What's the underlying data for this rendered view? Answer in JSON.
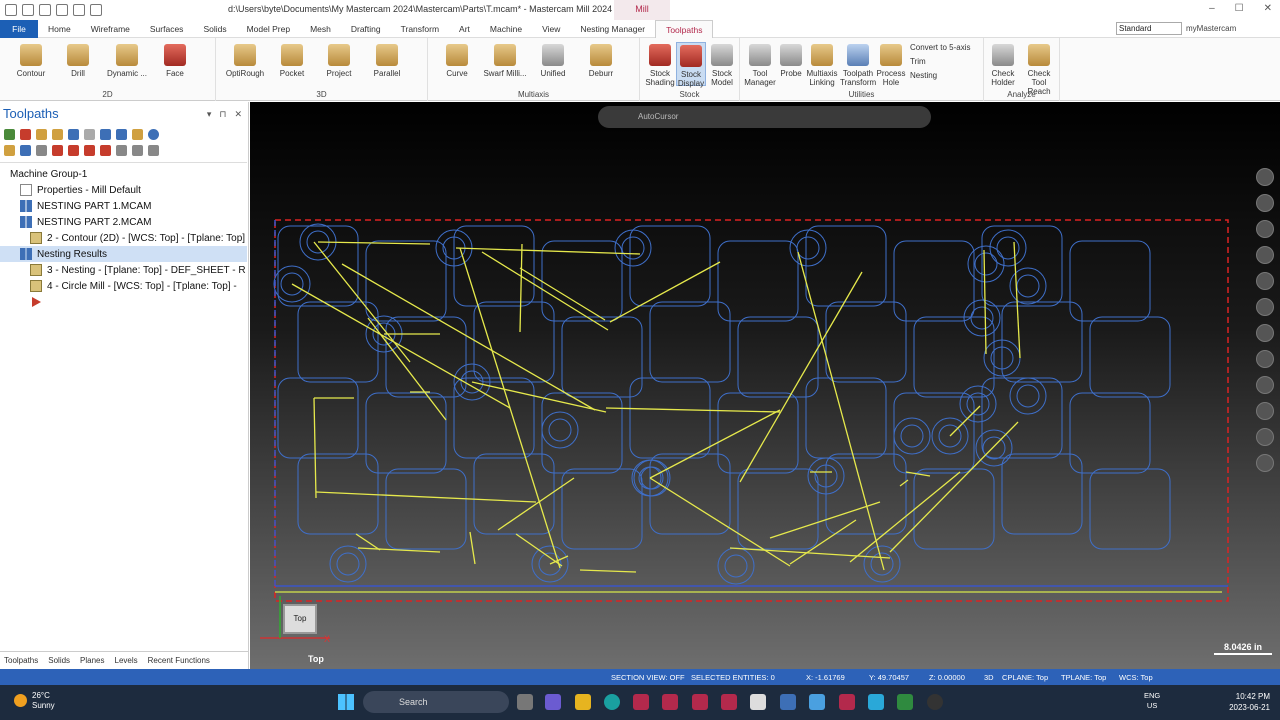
{
  "window": {
    "title": "d:\\Users\\byte\\Documents\\My Mastercam 2024\\Mastercam\\Parts\\T.mcam* - Mastercam Mill 2024",
    "context_tab": "Mill",
    "controls": [
      "–",
      "☐",
      "✕"
    ]
  },
  "tabs": [
    "File",
    "Home",
    "Wireframe",
    "Surfaces",
    "Solids",
    "Model Prep",
    "Mesh",
    "Drafting",
    "Transform",
    "Art",
    "Machine",
    "View",
    "Nesting Manager",
    "Toolpaths"
  ],
  "workspace": {
    "value": "Standard",
    "account": "myMastercam"
  },
  "ribbon": {
    "groups": [
      {
        "label": "2D",
        "buttons": [
          "Contour",
          "Drill",
          "Dynamic ...",
          "Face"
        ]
      },
      {
        "label": "3D",
        "buttons": [
          "OptiRough",
          "Pocket",
          "Project",
          "Parallel"
        ]
      },
      {
        "label": "Multiaxis",
        "buttons": [
          "Curve",
          "Swarf Milli...",
          "Unified",
          "Deburr"
        ]
      },
      {
        "label": "Stock",
        "buttons": [
          "Stock Shading",
          "Stock Display",
          "Stock Model"
        ]
      },
      {
        "label": "Utilities",
        "buttons": [
          "Tool Manager",
          "Probe",
          "Multiaxis Linking",
          "Toolpath Transform",
          "Process Hole"
        ],
        "small": [
          "Convert to 5-axis",
          "Trim",
          "Nesting"
        ]
      },
      {
        "label": "Analyze",
        "buttons": [
          "Check Holder",
          "Check Tool Reach"
        ]
      }
    ]
  },
  "sidebar": {
    "title": "Toolpaths",
    "tree": [
      {
        "label": "Machine Group-1",
        "indent": 0,
        "icon": "none"
      },
      {
        "label": "Properties - Mill Default",
        "indent": 1,
        "icon": "prop"
      },
      {
        "label": "NESTING PART 1.MCAM",
        "indent": 1,
        "icon": "grid"
      },
      {
        "label": "NESTING PART 2.MCAM",
        "indent": 1,
        "icon": "grid"
      },
      {
        "label": "2 - Contour (2D) - [WCS: Top] - [Tplane: Top]",
        "indent": 2,
        "icon": "tp"
      },
      {
        "label": "Nesting Results",
        "indent": 1,
        "icon": "grid",
        "selected": true
      },
      {
        "label": "3 - Nesting - [Tplane: Top] - DEF_SHEET - R",
        "indent": 2,
        "icon": "tp"
      },
      {
        "label": "4 - Circle Mill - [WCS: Top] - [Tplane: Top] -",
        "indent": 2,
        "icon": "tp"
      },
      {
        "label": "",
        "indent": 2,
        "icon": "arrow"
      }
    ],
    "bottom_tabs": [
      "Toolpaths",
      "Solids",
      "Planes",
      "Levels",
      "Recent Functions"
    ]
  },
  "viewport": {
    "autocursor": "AutoCursor",
    "view_cube": "Top",
    "view_name": "Top",
    "scale": "8.0426 in",
    "axis_x": "X"
  },
  "status": {
    "section_view": "SECTION VIEW: OFF",
    "selected": "SELECTED ENTITIES: 0",
    "x": "X:   -1.61769",
    "y": "Y:   49.70457",
    "z": "Z:   0.00000",
    "mode": "3D",
    "cplane": "CPLANE: Top",
    "tplane": "TPLANE: Top",
    "wcs": "WCS: Top"
  },
  "taskbar": {
    "temp": "26°C",
    "weather": "Sunny",
    "search": "Search",
    "lang": "ENG",
    "region": "US",
    "time": "10:42 PM",
    "date": "2023-06-21"
  }
}
